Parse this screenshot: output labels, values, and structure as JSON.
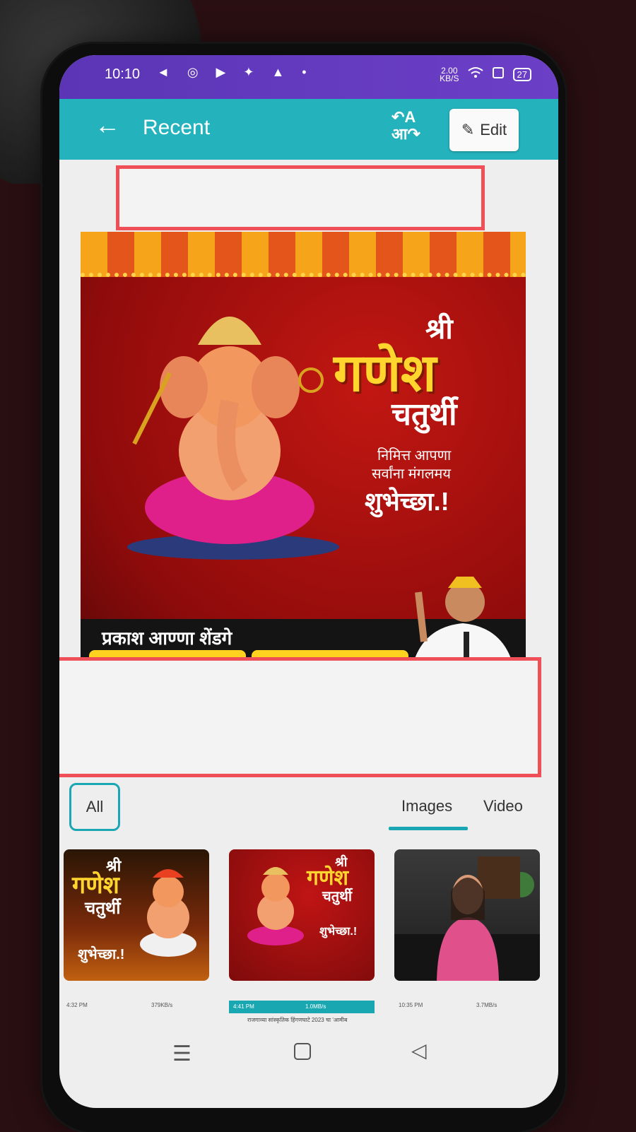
{
  "status_bar": {
    "time": "10:10",
    "notification_icons": "◄ ◎ ▶ ✦ ▲ •",
    "speed_value": "2.00",
    "speed_unit": "KB/S",
    "battery": "27"
  },
  "app_bar": {
    "back_icon": "←",
    "title": "Recent",
    "translate_icon_top": "↶A",
    "translate_icon_bottom": "आ↷",
    "edit_icon": "✎",
    "edit_label": "Edit"
  },
  "poster": {
    "title_small": "श्री",
    "title_big": "गणेश",
    "title_mid": "चतुर्थी",
    "wish_line1": "निमित्त आपणा",
    "wish_line2": "सर्वांना मंगलमय",
    "wish_line3": "शुभेच्छा.!",
    "leader_name": "प्रकाश आण्णा शेंडगे"
  },
  "tabs": {
    "all": "All",
    "images": "Images",
    "video": "Video"
  },
  "thumbnails": [
    {
      "small": "श्री",
      "big": "गणेश",
      "mid": "चतुर्थी",
      "wish": "शुभेच्छा.!"
    },
    {
      "small": "श्री",
      "big": "गणेश",
      "mid": "चतुर्थी",
      "wish": "शुभेच्छा.!"
    },
    {}
  ],
  "thumbnail_status": [
    {
      "time": "4:32 PM",
      "speed": "379KB/s"
    },
    {
      "time": "4:41 PM",
      "speed": "1.0MB/s"
    },
    {
      "time": "10:35 PM",
      "speed": "3.7MB/s"
    }
  ],
  "thumbnail_caption": "राजगाव्या सांस्कृतिक हिंगणघाटे 2023 चा 'आमीब",
  "nav": {
    "menu_icon": "☰",
    "back_icon": "◁"
  },
  "colors": {
    "status_bar": "#6c3fc7",
    "app_bar": "#24b3bd",
    "highlight": "#ef4f56",
    "tab_accent": "#1aa7b3",
    "poster_red": "#c21712",
    "poster_gold": "#ffd52e"
  }
}
